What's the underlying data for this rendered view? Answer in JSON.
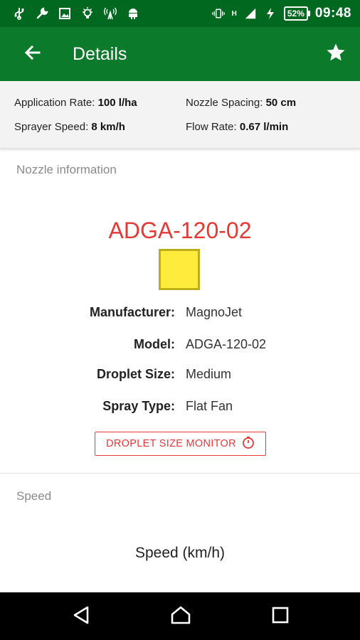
{
  "status_bar": {
    "left_icons": [
      "usb-icon",
      "wrench-icon",
      "image-icon",
      "lightbulb-icon",
      "signal-tower-icon",
      "android-icon"
    ],
    "right_icons": [
      "vibrate-icon",
      "network-signal-icon",
      "charging-icon"
    ],
    "network_label": "H",
    "battery": "52%",
    "time": "09:48"
  },
  "app_bar": {
    "title": "Details",
    "back_icon": "arrow-left-icon",
    "favorite_icon": "star-icon"
  },
  "summary": {
    "application_rate": {
      "label": "Application Rate:",
      "value": "100 l/ha"
    },
    "nozzle_spacing": {
      "label": "Nozzle Spacing:",
      "value": "50 cm"
    },
    "sprayer_speed": {
      "label": "Sprayer Speed:",
      "value": "8 km/h"
    },
    "flow_rate": {
      "label": "Flow Rate:",
      "value": "0.67 l/min"
    }
  },
  "nozzle_section": {
    "label": "Nozzle information",
    "nozzle_name": "ADGA-120-02",
    "swatch_color": "#ffeb3b",
    "details": [
      {
        "key": "Manufacturer:",
        "value": "MagnoJet"
      },
      {
        "key": "Model:",
        "value": "ADGA-120-02"
      },
      {
        "key": "Droplet Size:",
        "value": "Medium"
      },
      {
        "key": "Spray Type:",
        "value": "Flat Fan"
      }
    ],
    "monitor_button": "DROPLET SIZE MONITOR",
    "monitor_icon": "gauge-icon"
  },
  "speed_section": {
    "label": "Speed",
    "heading": "Speed (km/h)"
  },
  "nav_bar": {
    "icons": [
      "back-triangle-icon",
      "home-icon",
      "recents-square-icon"
    ]
  },
  "colors": {
    "status_bar": "#00691f",
    "app_bar": "#0b7a2b",
    "accent_red": "#e53935"
  }
}
